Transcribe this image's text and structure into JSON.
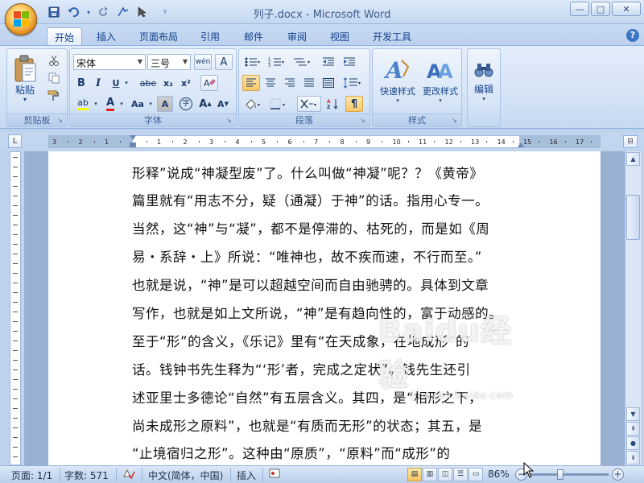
{
  "window": {
    "title": "列子.docx - Microsoft Word",
    "minimize": "—",
    "maximize": "□",
    "close": "✕"
  },
  "qat": {
    "save": "💾",
    "undo": "↶",
    "redo": "↻",
    "repeat": "▾",
    "customize": "▿"
  },
  "tabs": [
    "开始",
    "插入",
    "页面布局",
    "引用",
    "邮件",
    "审阅",
    "视图",
    "开发工具"
  ],
  "help_label": "?",
  "ribbon": {
    "clipboard": {
      "label": "剪贴板",
      "paste": "粘贴"
    },
    "font": {
      "label": "字体",
      "font_name": "宋体",
      "font_size": "三号",
      "bold": "B",
      "italic": "I",
      "underline": "U",
      "strike": "abe",
      "subscript": "x₂",
      "superscript": "x²",
      "clear": "A",
      "highlight": "ab",
      "font_color": "A",
      "change_case": "Aa",
      "char_shade": "A",
      "enclose": "字",
      "grow": "A",
      "shrink": "A",
      "phonetic": "wén",
      "char_border": "A"
    },
    "paragraph": {
      "label": "段落"
    },
    "styles": {
      "label": "样式",
      "quick_styles": "快速样式",
      "change_styles": "更改样式"
    },
    "editing": {
      "label": "编辑",
      "edit": "编辑"
    }
  },
  "ruler": {
    "ticks": [
      "3",
      "2",
      "1",
      "",
      "1",
      "2",
      "3",
      "4",
      "5",
      "6",
      "7",
      "8",
      "9",
      "10",
      "11",
      "12",
      "13",
      "14",
      "15",
      "16",
      "17"
    ]
  },
  "document": {
    "lines": [
      "形释”说成“神凝型废”了。什么叫做“神凝”呢？？《黄帝》",
      "篇里就有“用志不分，疑（通凝）于神”的话。指用心专一。",
      "当然，这“神”与“凝”，都不是停滞的、枯死的，而是如《周",
      "易・系辞・上》所说：“唯神也，故不疾而速，不行而至。”",
      "也就是说，“神”是可以超越空间而自由驰骋的。具体到文章",
      "写作，也就是如上文所说，“神”是有趋向性的，富于动感的。",
      "至于“形”的含义，《乐记》里有“在天成象，在地成形”的",
      "话。钱钟书先生释为“‘形’者，完成之定状”。钱先生还引",
      "述亚里士多德论“自然”有五层含义。其四，是“相形之下，",
      "尚未成形之原料”，也就是“有质而无形”的状态；其五，是",
      "“止境宿归之形”。这种由“原质”，“原料”而“成形”的"
    ]
  },
  "watermark": {
    "brand": "Baidu经验",
    "url": "jingyan.baidu.com"
  },
  "status": {
    "page": "页面: 1/1",
    "words": "字数: 571",
    "language": "中文(简体，中国)",
    "mode": "插入",
    "zoom": "86%",
    "zoom_minus": "−",
    "zoom_plus": "+"
  },
  "colors": {
    "ribbon_bg": "#d5e3f6",
    "accent": "#15428b",
    "selected": "#f9c66b"
  }
}
